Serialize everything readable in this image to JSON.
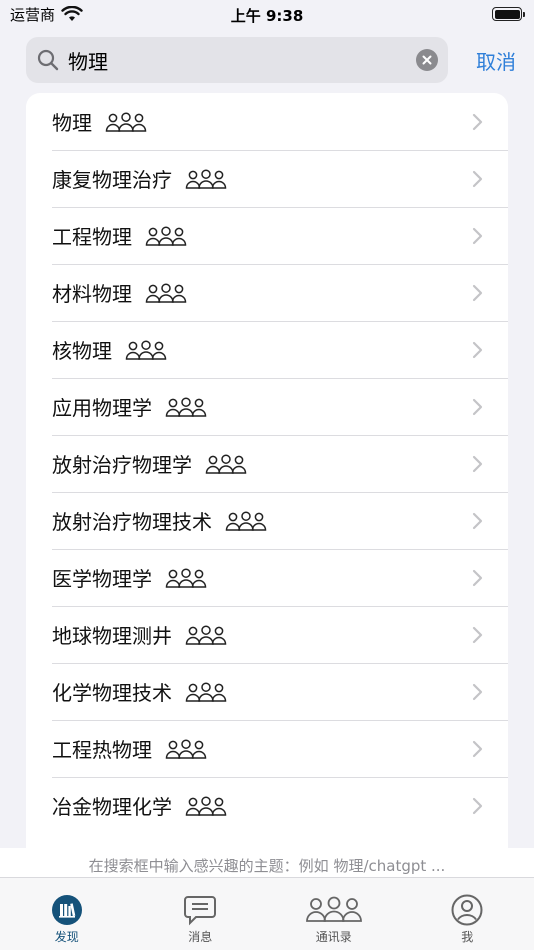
{
  "status_bar": {
    "carrier": "运营商",
    "time": "上午 9:38",
    "battery_level": 1.0
  },
  "search": {
    "query": "物理",
    "placeholder": "",
    "cancel_label": "取消"
  },
  "results": [
    {
      "title": "物理"
    },
    {
      "title": "康复物理治疗"
    },
    {
      "title": "工程物理"
    },
    {
      "title": "材料物理"
    },
    {
      "title": "核物理"
    },
    {
      "title": "应用物理学"
    },
    {
      "title": "放射治疗物理学"
    },
    {
      "title": "放射治疗物理技术"
    },
    {
      "title": "医学物理学"
    },
    {
      "title": "地球物理测井"
    },
    {
      "title": "化学物理技术"
    },
    {
      "title": "工程热物理"
    },
    {
      "title": "冶金物理化学"
    }
  ],
  "hint": "在搜索框中输入感兴趣的主题：例如 物理/chatgpt ...",
  "tabs": [
    {
      "label": "发现",
      "icon": "discover-icon",
      "active": true
    },
    {
      "label": "消息",
      "icon": "message-icon",
      "active": false
    },
    {
      "label": "通讯录",
      "icon": "contacts-icon",
      "active": false
    },
    {
      "label": "我",
      "icon": "profile-icon",
      "active": false
    }
  ],
  "colors": {
    "accent": "#2f7fd9",
    "tab_active": "#15527a",
    "separator": "#dcdce0"
  }
}
